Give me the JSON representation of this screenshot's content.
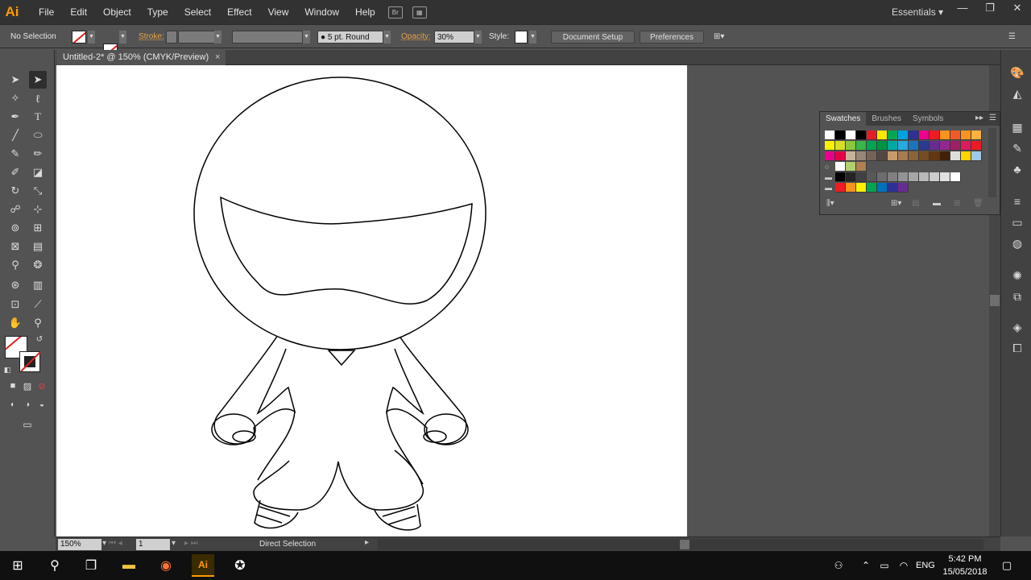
{
  "app": {
    "logo": "Ai",
    "workspace": "Essentials"
  },
  "menu": [
    "File",
    "Edit",
    "Object",
    "Type",
    "Select",
    "Effect",
    "View",
    "Window",
    "Help"
  ],
  "control": {
    "selection": "No Selection",
    "stroke_label": "Stroke:",
    "brush": "5 pt. Round",
    "opacity_label": "Opacity:",
    "opacity_value": "30%",
    "style_label": "Style:",
    "document_setup": "Document Setup",
    "preferences": "Preferences"
  },
  "document": {
    "tab_title": "Untitled-2* @ 150% (CMYK/Preview)",
    "close": "×"
  },
  "status": {
    "zoom": "150%",
    "page": "1",
    "state": "Direct Selection"
  },
  "swatches_panel": {
    "tabs": [
      "Swatches",
      "Brushes",
      "Symbols"
    ],
    "rows": [
      [
        "#ffffff",
        "#000000",
        "#ffffff",
        "#000000",
        "#e41e26",
        "#ffe600",
        "#00a651",
        "#00a3e0",
        "#2e3192",
        "#ec008c",
        "#ed1c24",
        "#f7941d",
        "#f15a24",
        "#f7931e",
        "#fbb040"
      ],
      [
        "#fff200",
        "#d7df23",
        "#8dc63f",
        "#39b54a",
        "#00a651",
        "#009444",
        "#00a99d",
        "#27aae1",
        "#1c75bc",
        "#2b3990",
        "#662d91",
        "#92278f",
        "#9e1f63",
        "#da1c5c",
        "#ed1c24"
      ],
      [
        "#ec008c",
        "#e40046",
        "#c7b299",
        "#998675",
        "#736357",
        "#534741",
        "#c69c6d",
        "#a67c52",
        "#8c6239",
        "#754c24",
        "#603813",
        "#42210b",
        "#dddddd",
        "#ffd400",
        "#a0c8e8"
      ],
      [
        "#ffffff",
        "#b0d070",
        "#b08050"
      ],
      [
        "#000000",
        "#242424",
        "#414141",
        "#585858",
        "#6d6d6d",
        "#808080",
        "#939393",
        "#a6a6a6",
        "#b9b9b9",
        "#cccccc",
        "#e0e0e0",
        "#ffffff"
      ],
      [
        "#ed1c24",
        "#f7941d",
        "#fff200",
        "#00a651",
        "#0072bc",
        "#2e3192",
        "#662d91"
      ]
    ]
  },
  "taskbar": {
    "lang": "ENG",
    "time": "5:42 PM",
    "date": "15/05/2018"
  },
  "colors": {
    "accent": "#ff9a00",
    "chrome": "#535353",
    "dark": "#323232"
  }
}
